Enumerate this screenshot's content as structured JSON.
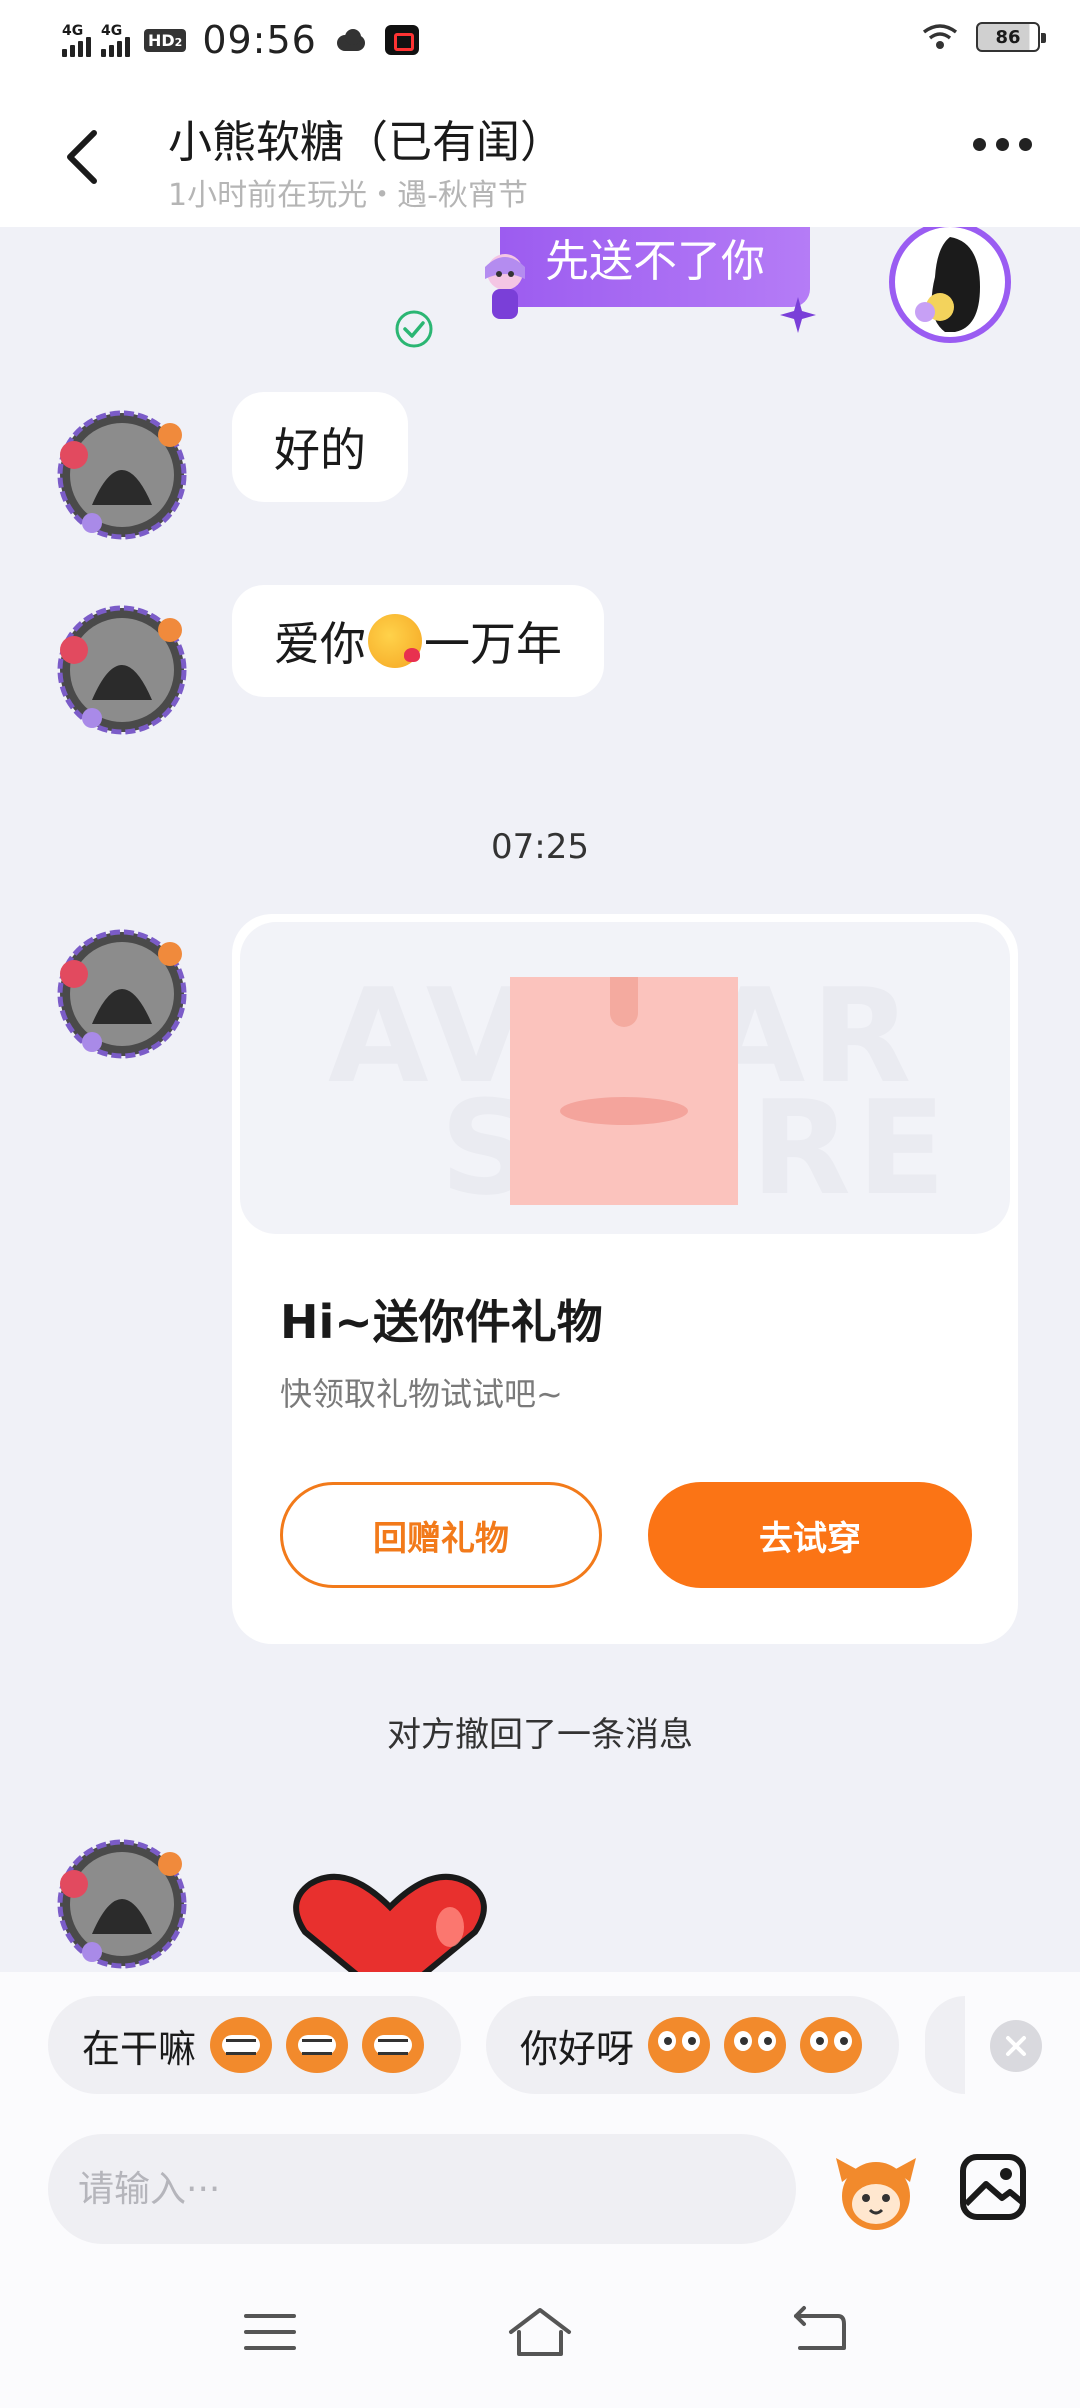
{
  "status_bar": {
    "network_1": "4G",
    "network_2": "4G",
    "hd_badge": "HD",
    "hd_sub": "2",
    "time": "09:56",
    "battery": "86"
  },
  "header": {
    "title": "小熊软糖（已有闺）",
    "subtitle": "1小时前在玩光・遇-秋宵节"
  },
  "messages": {
    "sent_text": "先送不了你",
    "received_1": "好的",
    "received_2_before": "爱你",
    "received_2_emoji": "kissing-face-emoji",
    "received_2_after": "一万年",
    "timestamp": "07:25",
    "recall_note": "对方撤回了一条消息"
  },
  "gift_card": {
    "watermark_top": "AVATAR",
    "watermark_bottom": "STORE",
    "title": "Hi~送你件礼物",
    "description": "快领取礼物试试吧~",
    "return_gift_label": "回赠礼物",
    "try_on_label": "去试穿",
    "accent_color": "#fb7415"
  },
  "quick_replies": [
    {
      "text": "在干嘛",
      "icon": "grinning-mascot-icon"
    },
    {
      "text": "你好呀",
      "icon": "curious-mascot-icon"
    }
  ],
  "input": {
    "placeholder": "请输入···"
  },
  "colors": {
    "sent_bubble": "#a66cf3",
    "background": "#f0f1f7",
    "read_check": "#2bb673"
  }
}
